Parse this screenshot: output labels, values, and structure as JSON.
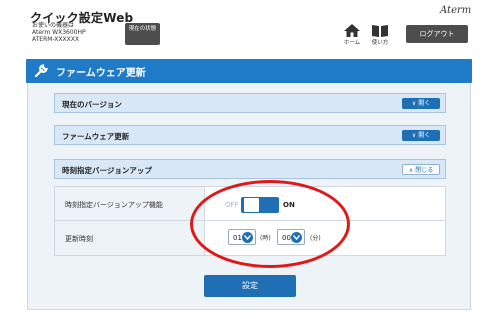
{
  "header": {
    "app_title": "クイック設定Web",
    "device_label": "お使いの機器は",
    "model": "Aterm WX3600HP",
    "device_id": "ATERM-XXXXXX",
    "status_button": "現在の状態",
    "brand": "Aterm",
    "home_label": "ホーム",
    "manual_label": "使い方",
    "logout_button": "ログアウト"
  },
  "panel": {
    "title": "ファームウェア更新",
    "sections": [
      {
        "label": "現在のバージョン",
        "button": "開く"
      },
      {
        "label": "ファームウェア更新",
        "button": "開く"
      },
      {
        "label": "時刻指定バージョンアップ",
        "button": "閉じる"
      }
    ]
  },
  "settings": {
    "auto_update_label": "時刻指定バージョンアップ機能",
    "toggle_off": "OFF",
    "toggle_on": "ON",
    "toggle_state": "ON",
    "update_time_label": "更新時刻",
    "hour_value": "01",
    "hour_unit": "(時)",
    "minute_value": "00",
    "minute_unit": "(分)"
  },
  "actions": {
    "submit": "設定"
  },
  "colors": {
    "accent": "#1f7ac8",
    "button": "#1f6fb4",
    "annotation": "#e01818"
  }
}
